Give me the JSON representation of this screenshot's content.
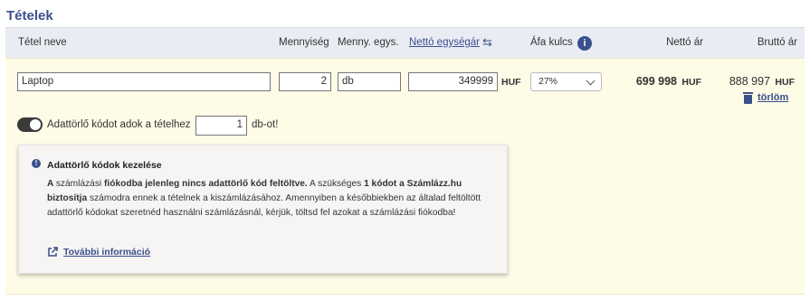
{
  "section": {
    "title": "Tételek"
  },
  "header": {
    "name": "Tétel neve",
    "quantity": "Mennyiség",
    "unit": "Menny. egys.",
    "net_unit_price": "Nettó egységár",
    "swap_icon": "swap-arrows-icon",
    "vat": "Áfa kulcs",
    "info_icon_glyph": "i",
    "net_price": "Nettó ár",
    "gross_price": "Bruttó ár"
  },
  "item": {
    "name": "Laptop",
    "quantity": "2",
    "unit": "db",
    "unit_price": "349999",
    "currency": "HUF",
    "vat": "27%",
    "net_total": "699 998",
    "gross_total": "888 997",
    "delete_label": "törlöm"
  },
  "data_deletion": {
    "toggle_on": true,
    "label": "Adattörlő kódot adok a tételhez",
    "count": "1",
    "suffix": "db-ot!"
  },
  "info": {
    "icon_glyph": "!",
    "title": "Adattörlő kódok kezelése",
    "body_1": "A ",
    "body_2": "számlázási ",
    "body_3": "fiókodba jelenleg nincs adattörlő kód feltöltve.",
    "body_4": " A szükséges ",
    "body_5": "1 kódot a Számlázz.hu biztosítja",
    "body_6": " számodra ennek a tételnek a kiszámlázásához. Amennyiben a későbbiekben az általad feltöltött adattörlő kódokat szeretnéd használni számlázásnál, kérjük, töltsd fel azokat a számlázási fiókodba!",
    "more_link": "További információ"
  },
  "colors": {
    "accent": "#3b4f8c",
    "row_bg": "#fefbe6",
    "header_bg": "#e9ecf3"
  }
}
